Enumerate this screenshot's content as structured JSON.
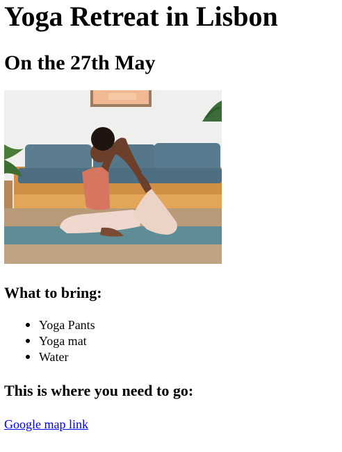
{
  "page": {
    "title": "Yoga Retreat in Lisbon",
    "subtitle": "On the 27th May",
    "image": {
      "alt": "Woman doing a yoga pose on a mat in a living room",
      "colors": {
        "wall": "#eeeeec",
        "sofa": "#56768a",
        "floor": "#b99a78",
        "mat": "#5f8d96",
        "frame": "#e2a98a"
      }
    },
    "bring_heading": "What to bring:",
    "bring_items": [
      "Yoga Pants",
      "Yoga mat",
      "Water"
    ],
    "where_heading": "This is where you need to go:",
    "map_link_text": "Google map link",
    "link_color": "#0000ee"
  }
}
